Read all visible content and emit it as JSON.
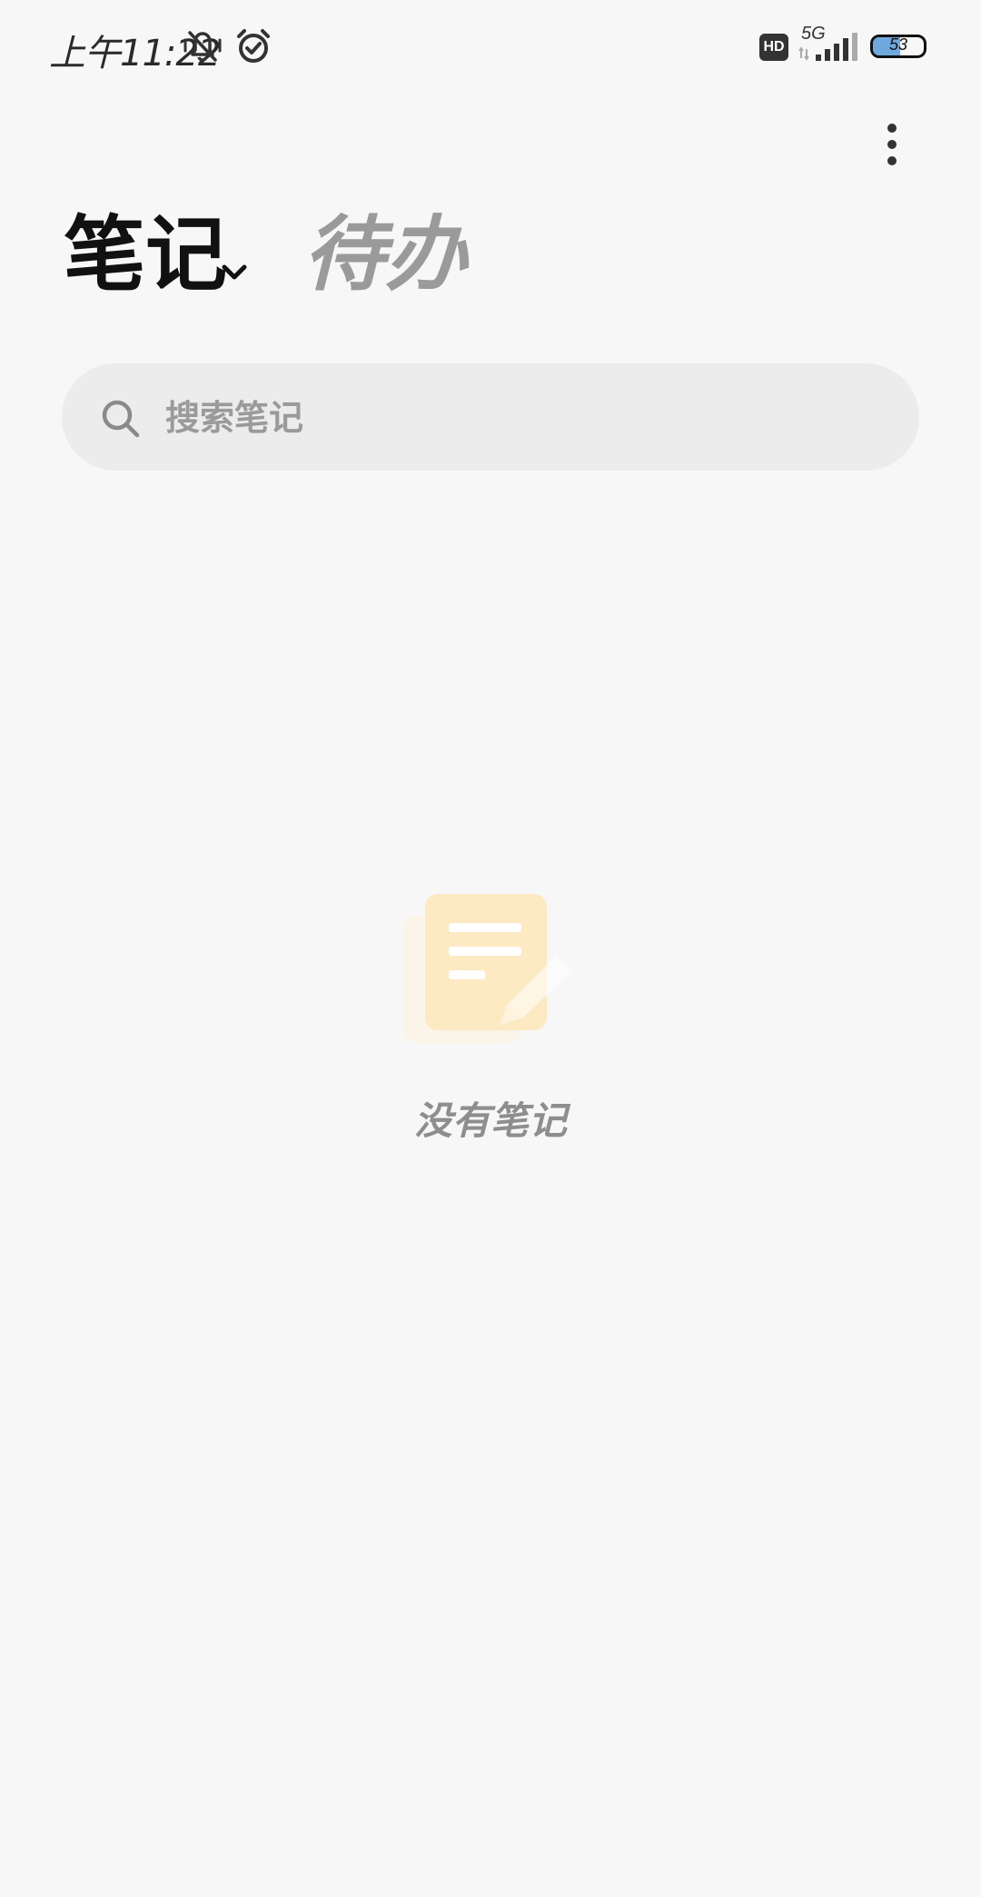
{
  "status_bar": {
    "time": "上午11:22",
    "icons": [
      "mute-icon",
      "alarm-icon",
      "hd-icon",
      "signal-icon",
      "battery-icon"
    ],
    "hd_label": "HD",
    "network_label": "5G",
    "battery_level": "53",
    "battery_fraction": 0.53
  },
  "header": {
    "more_icon": "more-vertical-icon"
  },
  "tabs": {
    "notes_label": "笔记",
    "todo_label": "待办",
    "dropdown_icon": "chevron-down-icon"
  },
  "search": {
    "placeholder": "搜索笔记",
    "value": ""
  },
  "empty_state": {
    "icon": "note-pencil-icon",
    "message": "没有笔记"
  },
  "colors": {
    "background": "#f7f7f7",
    "search_bg": "#ececec",
    "illustration_accent": "#fde9c2",
    "muted_text": "#8e8e8e"
  }
}
